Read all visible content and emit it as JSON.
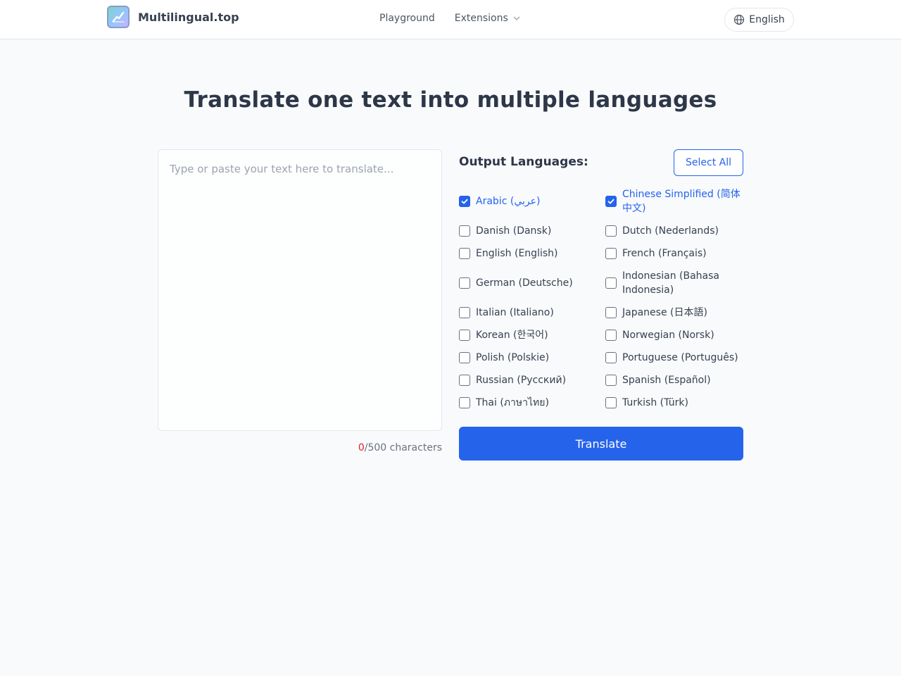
{
  "header": {
    "brand": "Multilingual.top",
    "logo_icon": "chart-up-icon",
    "nav": [
      {
        "label": "Playground"
      },
      {
        "label": "Extensions",
        "has_dropdown": true
      }
    ],
    "language_switch": {
      "icon": "globe-icon",
      "label": "English"
    }
  },
  "main": {
    "title": "Translate one text into multiple languages",
    "input": {
      "placeholder": "Type or paste your text here to translate...",
      "value": "",
      "count": "0",
      "count_suffix": "/500 characters"
    },
    "output": {
      "title": "Output Languages:",
      "select_all_label": "Select All",
      "languages": [
        {
          "label": "Arabic (عربي)",
          "checked": true
        },
        {
          "label": "Chinese Simplified (简体中文)",
          "checked": true
        },
        {
          "label": "Danish (Dansk)",
          "checked": false
        },
        {
          "label": "Dutch (Nederlands)",
          "checked": false
        },
        {
          "label": "English (English)",
          "checked": false
        },
        {
          "label": "French (Français)",
          "checked": false
        },
        {
          "label": "German (Deutsche)",
          "checked": false
        },
        {
          "label": "Indonesian (Bahasa Indonesia)",
          "checked": false
        },
        {
          "label": "Italian (Italiano)",
          "checked": false
        },
        {
          "label": "Japanese (日本語)",
          "checked": false
        },
        {
          "label": "Korean (한국어)",
          "checked": false
        },
        {
          "label": "Norwegian (Norsk)",
          "checked": false
        },
        {
          "label": "Polish (Polskie)",
          "checked": false
        },
        {
          "label": "Portuguese (Português)",
          "checked": false
        },
        {
          "label": "Russian (Русский)",
          "checked": false
        },
        {
          "label": "Spanish (Español)",
          "checked": false
        },
        {
          "label": "Thai (ภาษาไทย)",
          "checked": false
        },
        {
          "label": "Turkish (Türk)",
          "checked": false
        }
      ],
      "translate_label": "Translate"
    }
  },
  "colors": {
    "accent": "#2563eb",
    "count_zero": "#dc2626",
    "background": "#f8fafc"
  }
}
